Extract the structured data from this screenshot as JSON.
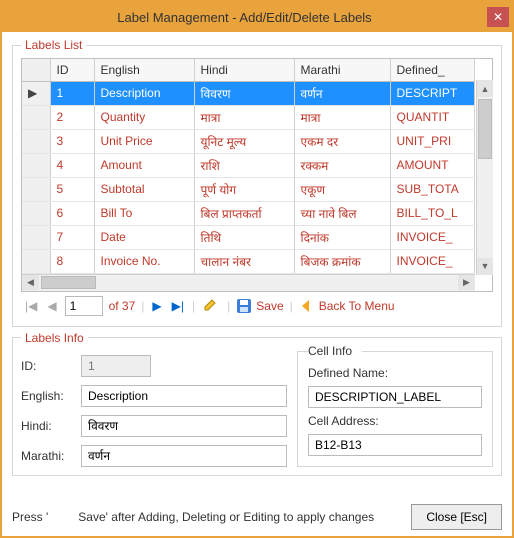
{
  "window": {
    "title": "Label Management - Add/Edit/Delete Labels"
  },
  "groups": {
    "list": "Labels List",
    "info": "Labels Info",
    "cell": "Cell Info"
  },
  "grid": {
    "columns": [
      "ID",
      "English",
      "Hindi",
      "Marathi",
      "Defined_"
    ],
    "rows": [
      {
        "id": "1",
        "en": "Description",
        "hi": "विवरण",
        "mr": "वर्णन",
        "def": "DESCRIPT"
      },
      {
        "id": "2",
        "en": "Quantity",
        "hi": "मात्रा",
        "mr": "मात्रा",
        "def": "QUANTIT"
      },
      {
        "id": "3",
        "en": "Unit Price",
        "hi": "यूनिट मूल्य",
        "mr": "एकम दर",
        "def": "UNIT_PRI"
      },
      {
        "id": "4",
        "en": "Amount",
        "hi": "राशि",
        "mr": "रक्कम",
        "def": "AMOUNT"
      },
      {
        "id": "5",
        "en": "Subtotal",
        "hi": "पूर्ण योग",
        "mr": "एकूण",
        "def": "SUB_TOTA"
      },
      {
        "id": "6",
        "en": "Bill To",
        "hi": "बिल प्राप्तकर्ता",
        "mr": "च्या नावे बिल",
        "def": "BILL_TO_L"
      },
      {
        "id": "7",
        "en": "Date",
        "hi": "तिथि",
        "mr": "दिनांक",
        "def": "INVOICE_"
      },
      {
        "id": "8",
        "en": "Invoice No.",
        "hi": "चालान नंबर",
        "mr": "बिजक क्रमांक",
        "def": "INVOICE_"
      }
    ],
    "selected": 0
  },
  "nav": {
    "page": "1",
    "of": "of 37",
    "save": "Save",
    "back": "Back To Menu"
  },
  "info": {
    "id_label": "ID:",
    "id_value": "1",
    "en_label": "English:",
    "en_value": "Description",
    "hi_label": "Hindi:",
    "hi_value": "विवरण",
    "mr_label": "Marathi:",
    "mr_value": "वर्णन"
  },
  "cell": {
    "defined_label": "Defined Name:",
    "defined_value": "DESCRIPTION_LABEL",
    "addr_label": "Cell Address:",
    "addr_value": "B12-B13"
  },
  "footer": {
    "hint": "Press '         Save' after Adding, Deleting or Editing to apply changes",
    "close": "Close [Esc]"
  }
}
